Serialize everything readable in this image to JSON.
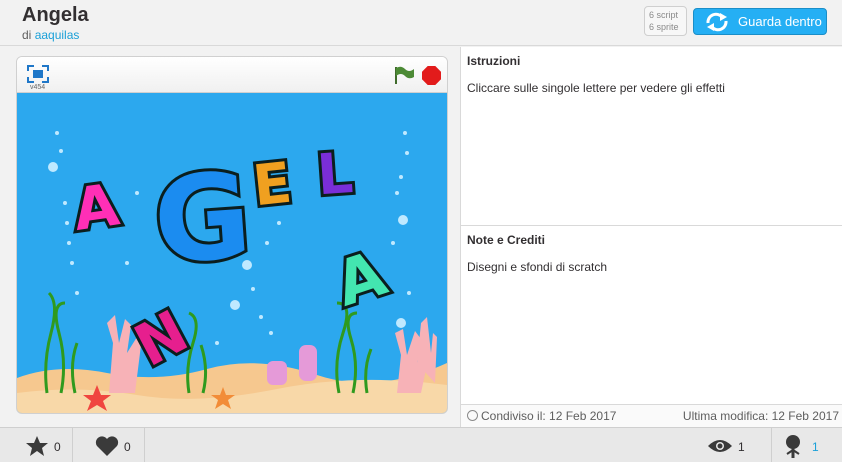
{
  "project": {
    "title": "Angela",
    "by_prefix": "di",
    "author": "aaquilas",
    "stats": [
      "6 script",
      "6 sprite"
    ],
    "see_inside_label": "Guarda dentro"
  },
  "player": {
    "version": "v454",
    "stage_letters": [
      "A",
      "G",
      "E",
      "L",
      "A",
      "N",
      "A"
    ]
  },
  "notes": {
    "instructions_title": "Istruzioni",
    "instructions_text": "Cliccare sulle singole lettere per vedere gli effetti",
    "credits_title": "Note e Crediti",
    "credits_text": "Disegni e sfondi di scratch",
    "shared": "Condiviso il: 12 Feb 2017",
    "modified": "Ultima modifica: 12 Feb 2017"
  },
  "footer": {
    "loves": "0",
    "favorites": "0",
    "views": "1",
    "remixes": "1"
  },
  "colors": {
    "accent": "#25aff4",
    "link": "#1aa0d8",
    "stage_water": "#2ca8ee"
  }
}
